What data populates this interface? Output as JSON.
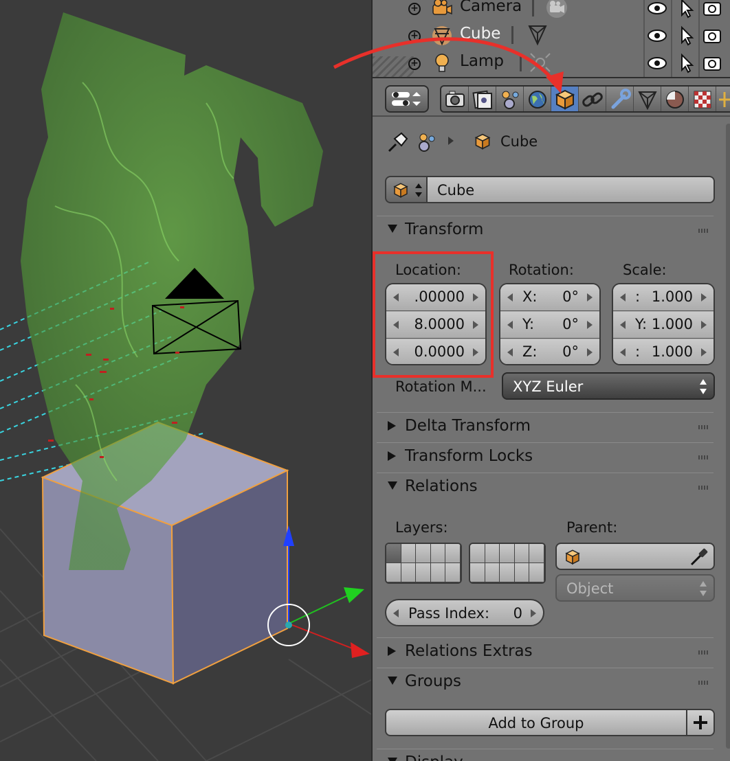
{
  "outliner": {
    "rows": [
      {
        "label": "Camera",
        "type_icon": "camera-object-icon",
        "data_icon": "camera-data-icon"
      },
      {
        "label": "Cube",
        "type_icon": "mesh-object-icon",
        "data_icon": "mesh-data-icon"
      },
      {
        "label": "Lamp",
        "type_icon": "lamp-object-icon",
        "data_icon": "lamp-data-icon"
      }
    ],
    "controls": [
      "visibility-eye-icon",
      "selectable-cursor-icon",
      "renderable-camera-icon"
    ]
  },
  "properties": {
    "tabs": [
      "render",
      "render-layers",
      "scene",
      "world",
      "object",
      "constraints",
      "modifiers",
      "data",
      "material",
      "texture",
      "particles"
    ],
    "active_tab": "object",
    "breadcrumb_object": "Cube",
    "object_name": "Cube",
    "transform": {
      "title": "Transform",
      "location_label": "Location:",
      "rotation_label": "Rotation:",
      "scale_label": "Scale:",
      "location": [
        ".00000",
        "8.0000",
        "0.0000"
      ],
      "rotation": [
        {
          "axis": "X:",
          "value": "0°"
        },
        {
          "axis": "Y:",
          "value": "0°"
        },
        {
          "axis": "Z:",
          "value": "0°"
        }
      ],
      "scale": [
        {
          "axis": ":",
          "value": "1.000"
        },
        {
          "axis": "Y:",
          "value": "1.000"
        },
        {
          "axis": ":",
          "value": "1.000"
        }
      ],
      "rotation_mode_label": "Rotation M...",
      "rotation_mode_value": "XYZ Euler"
    },
    "delta_transform_title": "Delta Transform",
    "transform_locks_title": "Transform Locks",
    "relations": {
      "title": "Relations",
      "layers_label": "Layers:",
      "parent_label": "Parent:",
      "parent_value": "",
      "parent_type": "Object",
      "pass_index_label": "Pass Index:",
      "pass_index_value": "0"
    },
    "relations_extras_title": "Relations Extras",
    "groups": {
      "title": "Groups",
      "add_button": "Add to Group"
    },
    "display_title": "Display"
  },
  "colors": {
    "annotation": "#e8302a",
    "active_tab": "#5680c2",
    "smoke": "#5aa83c",
    "cube_face": "#8a8aa6",
    "selection_outline": "#f0a040"
  }
}
